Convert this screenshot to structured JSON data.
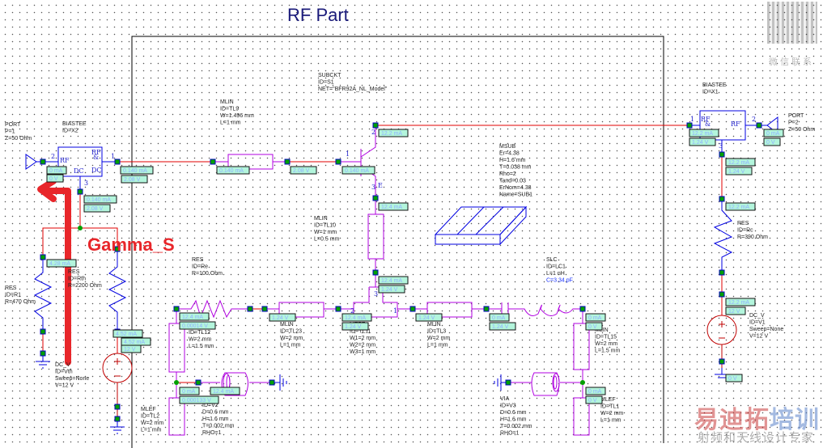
{
  "title": "RF Part",
  "annotation_overlay": "Gamma_S",
  "colors": {
    "wire_dc": "#e00000",
    "component": "#0000e0",
    "microstrip": "#b000e0",
    "source": "#c00000",
    "node": "#00a000",
    "arrow": "#e8262a"
  },
  "components": {
    "port1": [
      "PORT",
      "P=1",
      "Z=50 Ohm"
    ],
    "biastee_x2": [
      "BIASTEE",
      "ID=X2"
    ],
    "mlin_tl9": [
      "MLIN",
      "ID=TL9",
      "W=1.496 mm",
      "L=1 mm"
    ],
    "subckt_s1": [
      "SUBCKT",
      "ID=S1",
      "NET=\"BFR92A_NL_Model\""
    ],
    "msub": [
      "MSUB",
      "Er=4.38",
      "H=1.6 mm",
      "T=0.038 mm",
      "Rho=2",
      "Tand=0.03",
      "ErNom=4.38",
      "Name=SUB1"
    ],
    "biastee_x1": [
      "BIASTEE",
      "ID=X1"
    ],
    "port2": [
      "PORT",
      "P=2",
      "Z=50 Ohm"
    ],
    "res_rc": [
      "RES",
      "ID=Rc",
      "R=390 Ohm"
    ],
    "dcv_v1": [
      "DC_V",
      "ID=V1",
      "Sweep=None",
      "V=12 V"
    ],
    "mlin_tl10": [
      "MLIN",
      "ID=TL10",
      "W=1 mm",
      "L=0.5 mm"
    ],
    "res_re": [
      "RES",
      "ID=Re",
      "R=100 Ohm"
    ],
    "res_rth": [
      "RES",
      "ID=Rth",
      "R=2200 Ohm"
    ],
    "res_r1": [
      "RES",
      "ID=R1",
      "R=470 Ohm"
    ],
    "dcv_vth": [
      "DC_V",
      "ID=Vth",
      "Sweep=None",
      "V=12 V"
    ],
    "mlin_tl12": [
      "ID=TL12",
      "W=2 mm",
      "L=1.5 mm"
    ],
    "mlin_tl23": [
      "MLIN",
      "ID=TL23",
      "W=2 mm",
      "L=1 mm"
    ],
    "mtee_tl11": [
      "MTEE",
      "ID=TL11",
      "W1=2 mm",
      "W2=2 mm",
      "W3=1 mm"
    ],
    "mlin_tl3": [
      "MLIN",
      "ID=TL3",
      "W=2 mm",
      "L=1 mm"
    ],
    "slc_lc1": [
      "SLC",
      "ID=LC1",
      "L=1 nH",
      "C=3.34 pF"
    ],
    "mlin_tl15": [
      "MLIN",
      "ID=TL15",
      "W=2 mm",
      "L=1.5 mm"
    ],
    "mlef_tl2": [
      "MLEF",
      "ID=TL2",
      "W=2 mm",
      "L=1 mm"
    ],
    "via_v2": [
      "ID=V2",
      "D=0.6 mm",
      "H=1.6 mm",
      "T=0.002 mm",
      "RHO=1"
    ],
    "via_v3": [
      "VIA",
      "ID=V3",
      "D=0.6 mm",
      "H=1.6 mm",
      "T=0.002 mm",
      "RHO=1"
    ],
    "mlef_tl1": [
      "MLEF",
      "ID=TL1",
      "W=2 mm",
      "L=1 mm"
    ]
  },
  "pins": [
    "2",
    "RF",
    "RF",
    "&",
    "DC",
    "DC",
    "1",
    "3",
    "1",
    "2",
    "3",
    "E",
    "1",
    "RF",
    "&",
    "DC",
    "RF",
    "2",
    "3",
    "2",
    "1",
    "3"
  ],
  "measurements": [
    "0 mA",
    "0 V",
    "0.140 mA",
    "2.08 V",
    "0.140 mA",
    "2.08 V",
    "0.140 mA",
    "2.08 V",
    "0.140 mA",
    "12.2 mA",
    "12.4 mA",
    "12.4 mA",
    "1.24 V",
    "4.28 mA",
    "4.52 mA",
    "4.52 mA",
    "12 V",
    "12.4 mA",
    "0.00014 V",
    "1.24 V",
    "12.4 mA",
    "1.24 V",
    "1.24 V",
    "0 mA",
    "1.24 V",
    "0 mA",
    "0 V",
    "0 mA",
    "0.000133 V",
    "12.4 mA",
    "0 mA",
    "0 V",
    "12.2 mA",
    "1.24 V",
    "0 mA",
    "0 V",
    "12.2 mA",
    "1.24 V",
    "12.2 mA",
    "12.2 mA",
    "12 V",
    "0 V"
  ],
  "watermark": {
    "brand_a": "易迪拓",
    "brand_b": "培训",
    "tagline": "射频和天线设计专家",
    "qr_caption": "微信联系"
  }
}
